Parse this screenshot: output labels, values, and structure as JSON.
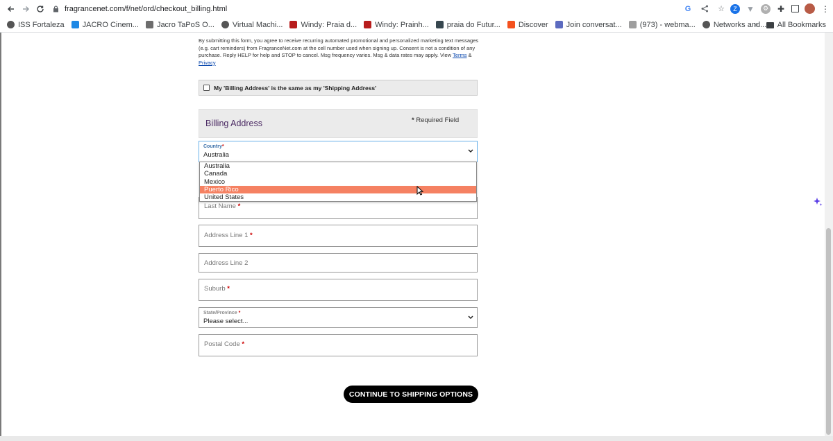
{
  "browser": {
    "url": "fragrancenet.com/f/net/ord/checkout_billing.html",
    "bookmarks": [
      {
        "label": "ISS Fortaleza",
        "icon": "globe-icon",
        "color": "#555555"
      },
      {
        "label": "JACRO Cinem...",
        "icon": "jacro-icon",
        "color": "#1e88e5"
      },
      {
        "label": "Jacro TaPoS O...",
        "icon": "table-icon",
        "color": "#6d6d6d"
      },
      {
        "label": "Virtual Machi...",
        "icon": "globe-icon",
        "color": "#555555"
      },
      {
        "label": "Windy: Praia d...",
        "icon": "windy-icon",
        "color": "#b71c1c"
      },
      {
        "label": "Windy: Prainh...",
        "icon": "windy-icon",
        "color": "#b71c1c"
      },
      {
        "label": "praia do Futur...",
        "icon": "photo-icon",
        "color": "#37474f"
      },
      {
        "label": "Discover",
        "icon": "discover-icon",
        "color": "#f4511e"
      },
      {
        "label": "Join conversat...",
        "icon": "teams-icon",
        "color": "#5c6bc0"
      },
      {
        "label": "(973) - webma...",
        "icon": "mail-icon",
        "color": "#9e9e9e"
      },
      {
        "label": "Networks and...",
        "icon": "globe-icon",
        "color": "#555555"
      }
    ],
    "overflow_label": "»",
    "all_bookmarks_label": "All Bookmarks"
  },
  "disclaimer": {
    "text": "By submitting this form, you agree to receive recurring automated promotional and personalized marketing text messages (e.g. cart reminders) from FragranceNet.com at the cell number used when signing up. Consent is not a condition of any purchase. Reply HELP for help and STOP to cancel. Msg frequency varies. Msg & data rates may apply. View ",
    "terms_link": "Terms",
    "amp": " & ",
    "privacy_link": "Privacy"
  },
  "same_address": {
    "label": "My 'Billing Address' is the same as my 'Shipping Address'",
    "checked": false
  },
  "billing": {
    "title": "Billing Address",
    "required_star": "*",
    "required_text": "Required Field"
  },
  "country": {
    "label": "Country",
    "star": "*",
    "value": "Australia",
    "options": [
      "Australia",
      "Canada",
      "Mexico",
      "Puerto Rico",
      "United States"
    ],
    "highlighted": "Puerto Rico"
  },
  "fields": {
    "last_name": "Last Name",
    "address1": "Address Line 1",
    "address2": "Address Line 2",
    "suburb": "Suburb",
    "postal": "Postal Code",
    "star": "*"
  },
  "state": {
    "label": "State/Province",
    "star": "*",
    "value": "Please select..."
  },
  "continue_label": "CONTINUE TO SHIPPING OPTIONS",
  "colors": {
    "accent_highlight": "#f58162",
    "title_purple": "#4b2a63",
    "button_bg": "#000000"
  }
}
